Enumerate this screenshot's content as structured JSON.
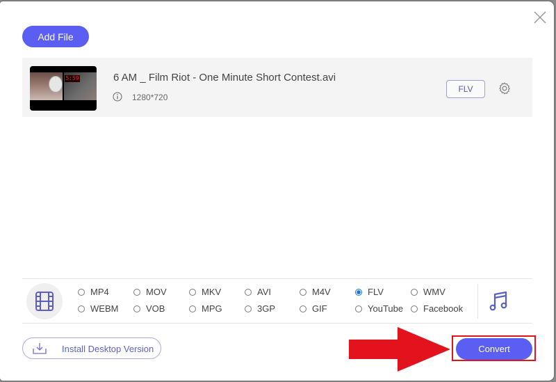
{
  "header": {
    "add_file_label": "Add File",
    "close_icon": "close-icon"
  },
  "file": {
    "name": "6 AM _ Film Riot - One Minute Short Contest.avi",
    "resolution": "1280*720",
    "thumbnail_clock_text": "5:59",
    "output_format": "FLV"
  },
  "formats": {
    "video_icon": "film-icon",
    "audio_icon": "music-note-icon",
    "selected": "FLV",
    "options": [
      {
        "label": "MP4",
        "selected": false
      },
      {
        "label": "MOV",
        "selected": false
      },
      {
        "label": "MKV",
        "selected": false
      },
      {
        "label": "AVI",
        "selected": false
      },
      {
        "label": "M4V",
        "selected": false
      },
      {
        "label": "FLV",
        "selected": true
      },
      {
        "label": "WMV",
        "selected": false
      },
      {
        "label": "WEBM",
        "selected": false
      },
      {
        "label": "VOB",
        "selected": false
      },
      {
        "label": "MPG",
        "selected": false
      },
      {
        "label": "3GP",
        "selected": false
      },
      {
        "label": "GIF",
        "selected": false
      },
      {
        "label": "YouTube",
        "selected": false
      },
      {
        "label": "Facebook",
        "selected": false
      }
    ]
  },
  "footer": {
    "install_label": "Install Desktop Version",
    "convert_label": "Convert"
  },
  "colors": {
    "accent": "#5b5ef2",
    "annotation_red": "#e3131e",
    "radio_selected": "#1a73e8"
  }
}
